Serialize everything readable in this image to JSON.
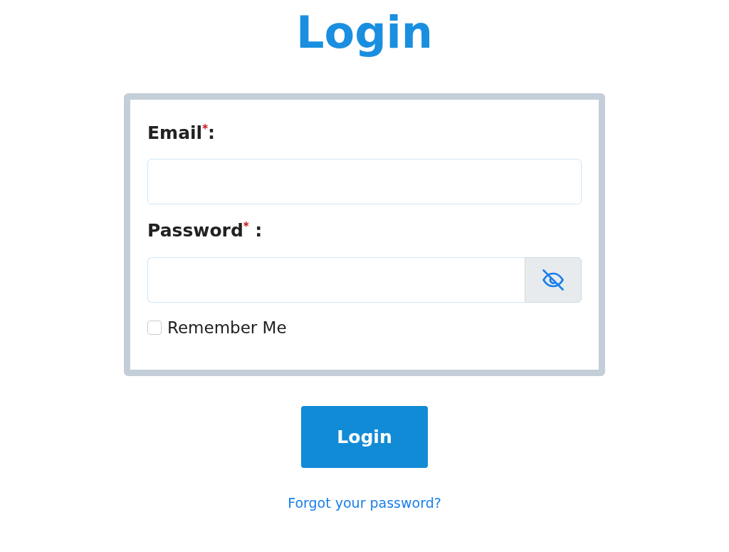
{
  "title": "Login",
  "fields": [
    {
      "label": "Email$^{*}$:",
      "kind": "email"
    },
    {
      "label": "Password$^{*}$ :",
      "kind": "password"
    }
  ],
  "remember": {
    "label": "Remember Me",
    "checked": false
  },
  "submit": "Login",
  "forgot_link": "Forgot your password?"
}
